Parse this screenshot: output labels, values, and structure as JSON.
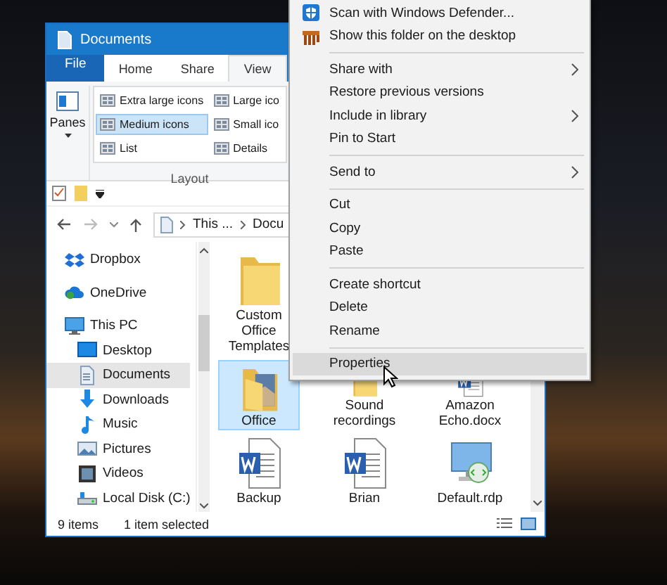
{
  "window": {
    "title": "Documents"
  },
  "ribbon_tabs": [
    {
      "label": "File",
      "kind": "file",
      "selected": false
    },
    {
      "label": "Home",
      "kind": "tab",
      "selected": false
    },
    {
      "label": "Share",
      "kind": "tab",
      "selected": false
    },
    {
      "label": "View",
      "kind": "tab",
      "selected": true
    }
  ],
  "ribbon": {
    "panes_label": "Panes",
    "group_label": "Layout",
    "layout_options": [
      {
        "label": "Extra large icons",
        "selected": false
      },
      {
        "label": "Large ico",
        "selected": false
      },
      {
        "label": "Medium icons",
        "selected": true
      },
      {
        "label": "Small ico",
        "selected": false
      },
      {
        "label": "List",
        "selected": false
      },
      {
        "label": "Details",
        "selected": false
      }
    ]
  },
  "address": {
    "path": [
      "This ...",
      "Docu"
    ]
  },
  "nav_items": [
    {
      "label": "Dropbox",
      "selected": false
    },
    {
      "label": "OneDrive",
      "selected": false
    },
    {
      "label": "This PC",
      "selected": false,
      "children": [
        {
          "label": "Desktop",
          "selected": false
        },
        {
          "label": "Documents",
          "selected": true
        },
        {
          "label": "Downloads",
          "selected": false
        },
        {
          "label": "Music",
          "selected": false
        },
        {
          "label": "Pictures",
          "selected": false
        },
        {
          "label": "Videos",
          "selected": false
        },
        {
          "label": "Local Disk (C:)",
          "selected": false
        }
      ]
    }
  ],
  "file_rows": [
    [
      {
        "name": "Custom Office Templates",
        "kind": "folder",
        "selected": false
      }
    ],
    [
      {
        "name": "Office",
        "kind": "photo-folder",
        "selected": true
      },
      {
        "name": "Sound recordings",
        "kind": "folder",
        "selected": false
      },
      {
        "name": "Amazon Echo.docx",
        "kind": "word",
        "selected": false
      }
    ],
    [
      {
        "name": "Backup",
        "kind": "word",
        "selected": false
      },
      {
        "name": "Brian",
        "kind": "word",
        "selected": false
      },
      {
        "name": "Default.rdp",
        "kind": "rdp",
        "selected": false
      }
    ]
  ],
  "status_bar": {
    "item_count": "9 items",
    "selection": "1 item selected"
  },
  "context_menu": {
    "groups": [
      [
        {
          "label": "Scan with Windows Defender...",
          "submenu": false,
          "selected": false
        },
        {
          "label": "Show this folder on the desktop",
          "submenu": false,
          "selected": false
        }
      ],
      [
        {
          "label": "Share with",
          "submenu": true,
          "selected": false
        },
        {
          "label": "Restore previous versions",
          "submenu": false,
          "selected": false
        },
        {
          "label": "Include in library",
          "submenu": true,
          "selected": false
        },
        {
          "label": "Pin to Start",
          "submenu": false,
          "selected": false
        }
      ],
      [
        {
          "label": "Send to",
          "submenu": true,
          "selected": false
        }
      ],
      [
        {
          "label": "Cut",
          "submenu": false,
          "selected": false
        },
        {
          "label": "Copy",
          "submenu": false,
          "selected": false
        },
        {
          "label": "Paste",
          "submenu": false,
          "selected": false
        }
      ],
      [
        {
          "label": "Create shortcut",
          "submenu": false,
          "selected": false
        },
        {
          "label": "Delete",
          "submenu": false,
          "selected": false
        },
        {
          "label": "Rename",
          "submenu": false,
          "selected": false
        }
      ],
      [
        {
          "label": "Properties",
          "submenu": false,
          "selected": true
        }
      ]
    ]
  }
}
